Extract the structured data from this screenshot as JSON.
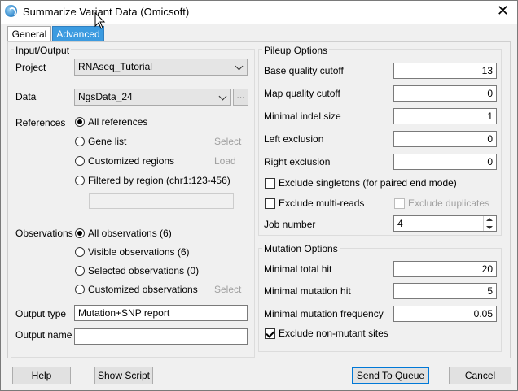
{
  "window": {
    "title": "Summarize Variant Data (Omicsoft)"
  },
  "tabs": [
    {
      "label": "General",
      "active": true
    },
    {
      "label": "Advanced",
      "active": false
    }
  ],
  "io": {
    "group_title": "Input/Output",
    "project_label": "Project",
    "project_value": "RNAseq_Tutorial",
    "data_label": "Data",
    "data_value": "NgsData_24",
    "browse_label": "...",
    "references_label": "References",
    "references_options": [
      {
        "label": "All references",
        "checked": true,
        "action": ""
      },
      {
        "label": "Gene list",
        "checked": false,
        "action": "Select"
      },
      {
        "label": "Customized regions",
        "checked": false,
        "action": "Load"
      },
      {
        "label": "Filtered by region (chr1:123-456)",
        "checked": false,
        "action": ""
      }
    ],
    "region_value": "",
    "observations_label": "Observations",
    "observations_options": [
      {
        "label": "All observations (6)",
        "checked": true,
        "action": ""
      },
      {
        "label": "Visible observations (6)",
        "checked": false,
        "action": ""
      },
      {
        "label": "Selected observations (0)",
        "checked": false,
        "action": ""
      },
      {
        "label": "Customized observations",
        "checked": false,
        "action": "Select"
      }
    ],
    "output_type_label": "Output type",
    "output_type_value": "Mutation+SNP report",
    "output_name_label": "Output name",
    "output_name_value": ""
  },
  "pileup": {
    "group_title": "Pileup Options",
    "fields": [
      {
        "label": "Base quality cutoff",
        "value": "13"
      },
      {
        "label": "Map quality cutoff",
        "value": "0"
      },
      {
        "label": "Minimal indel size",
        "value": "1"
      },
      {
        "label": "Left exclusion",
        "value": "0"
      },
      {
        "label": "Right exclusion",
        "value": "0"
      }
    ],
    "exclude_singletons": {
      "label": "Exclude singletons (for paired end mode)",
      "checked": false
    },
    "exclude_multireads": {
      "label": "Exclude multi-reads",
      "checked": false
    },
    "exclude_duplicates": {
      "label": "Exclude duplicates",
      "checked": false,
      "enabled": false
    },
    "job_number_label": "Job number",
    "job_number_value": "4"
  },
  "mutation": {
    "group_title": "Mutation Options",
    "fields": [
      {
        "label": "Minimal total hit",
        "value": "20"
      },
      {
        "label": "Minimal mutation hit",
        "value": "5"
      },
      {
        "label": "Minimal mutation frequency",
        "value": "0.05"
      }
    ],
    "exclude_nonmutant": {
      "label": "Exclude non-mutant sites",
      "checked": true
    }
  },
  "buttons": {
    "help": "Help",
    "show_script": "Show Script",
    "send_to_queue": "Send To Queue",
    "cancel": "Cancel"
  },
  "icons": {
    "app": "omicsoft-app-icon",
    "close": "close-icon",
    "cursor": "mouse-cursor-icon"
  },
  "colors": {
    "accent": "#0078d7",
    "active_tab": "#3c9be0"
  }
}
